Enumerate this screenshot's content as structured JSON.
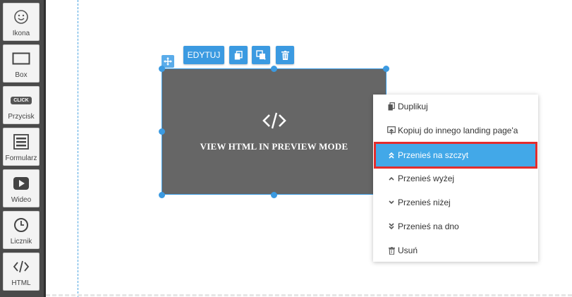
{
  "sidebar": {
    "items": [
      {
        "label": "Ikona",
        "icon": "smiley-icon"
      },
      {
        "label": "Box",
        "icon": "box-icon"
      },
      {
        "label": "Przycisk",
        "icon": "click-button-icon",
        "badge": "CLICK"
      },
      {
        "label": "Formularz",
        "icon": "form-icon"
      },
      {
        "label": "Wideo",
        "icon": "video-play-icon"
      },
      {
        "label": "Licznik",
        "icon": "clock-icon"
      },
      {
        "label": "HTML",
        "icon": "code-icon"
      }
    ]
  },
  "toolbar": {
    "edit_label": "EDYTUJ",
    "icons": [
      "copy-icon",
      "layers-icon",
      "trash-icon"
    ]
  },
  "widget": {
    "caption": "VIEW HTML IN PREVIEW MODE",
    "icon": "code-icon"
  },
  "context_menu": {
    "items": [
      {
        "label": "Duplikuj",
        "icon": "duplicate-icon"
      },
      {
        "label": "Kopiuj do innego landing page'a",
        "icon": "copy-to-page-icon"
      },
      {
        "label": "Przenieś na szczyt",
        "icon": "double-chevron-up-icon",
        "active": true
      },
      {
        "label": "Przenieś wyżej",
        "icon": "chevron-up-icon"
      },
      {
        "label": "Przenieś niżej",
        "icon": "chevron-down-icon"
      },
      {
        "label": "Przenieś na dno",
        "icon": "double-chevron-down-icon"
      },
      {
        "label": "Usuń",
        "icon": "trash-icon"
      }
    ]
  },
  "colors": {
    "accent": "#3b9ae1",
    "menu_active": "#42a8e8",
    "highlight_border": "#e32c2c",
    "sidebar_bg": "#4a4a4a",
    "widget_bg": "#666666"
  }
}
